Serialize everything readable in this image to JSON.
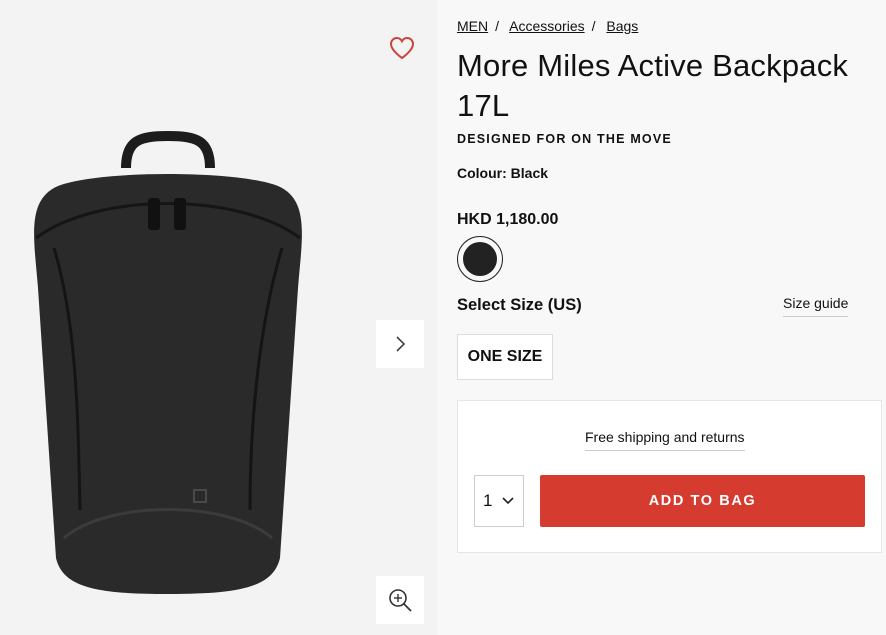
{
  "breadcrumb": {
    "items": [
      "MEN",
      "Accessories",
      "Bags"
    ],
    "separator": "/"
  },
  "product": {
    "title": "More Miles Active Backpack 17L",
    "tagline": "DESIGNED FOR ON THE MOVE",
    "colour_label": "Colour:",
    "colour_value": "Black",
    "price": "HKD 1,180.00",
    "swatch_color": "#222222"
  },
  "size": {
    "label": "Select Size (US)",
    "guide_link": "Size guide",
    "options": [
      "ONE SIZE"
    ]
  },
  "cart": {
    "shipping_text": "Free shipping and returns",
    "quantity": "1",
    "add_button": "ADD TO BAG",
    "button_color": "#d63b30"
  },
  "icons": {
    "wishlist": "heart-icon",
    "next": "chevron-right-icon",
    "zoom": "zoom-in-icon",
    "qty": "chevron-down-icon"
  }
}
